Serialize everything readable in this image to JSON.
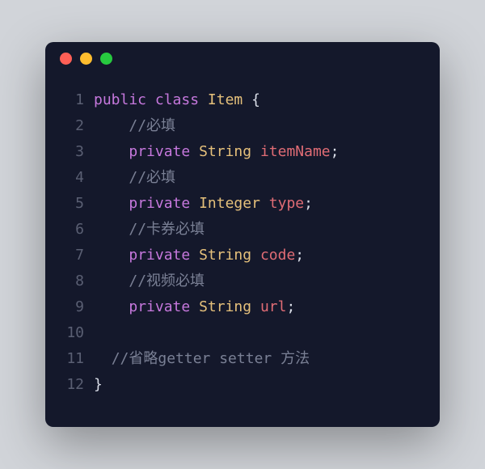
{
  "code": {
    "lines": [
      {
        "n": "1",
        "tokens": [
          {
            "c": "kw",
            "t": "public"
          },
          {
            "c": "pl",
            "t": " "
          },
          {
            "c": "kw",
            "t": "class"
          },
          {
            "c": "pl",
            "t": " "
          },
          {
            "c": "cls",
            "t": "Item"
          },
          {
            "c": "pl",
            "t": " {"
          }
        ]
      },
      {
        "n": "2",
        "tokens": [
          {
            "c": "pl",
            "t": "    "
          },
          {
            "c": "cm",
            "t": "//必填"
          }
        ]
      },
      {
        "n": "3",
        "tokens": [
          {
            "c": "pl",
            "t": "    "
          },
          {
            "c": "kw",
            "t": "private"
          },
          {
            "c": "pl",
            "t": " "
          },
          {
            "c": "ty",
            "t": "String"
          },
          {
            "c": "pl",
            "t": " "
          },
          {
            "c": "id",
            "t": "itemName"
          },
          {
            "c": "pl",
            "t": ";"
          }
        ]
      },
      {
        "n": "4",
        "tokens": [
          {
            "c": "pl",
            "t": "    "
          },
          {
            "c": "cm",
            "t": "//必填"
          }
        ]
      },
      {
        "n": "5",
        "tokens": [
          {
            "c": "pl",
            "t": "    "
          },
          {
            "c": "kw",
            "t": "private"
          },
          {
            "c": "pl",
            "t": " "
          },
          {
            "c": "ty",
            "t": "Integer"
          },
          {
            "c": "pl",
            "t": " "
          },
          {
            "c": "id",
            "t": "type"
          },
          {
            "c": "pl",
            "t": ";"
          }
        ]
      },
      {
        "n": "6",
        "tokens": [
          {
            "c": "pl",
            "t": "    "
          },
          {
            "c": "cm",
            "t": "//卡券必填"
          }
        ]
      },
      {
        "n": "7",
        "tokens": [
          {
            "c": "pl",
            "t": "    "
          },
          {
            "c": "kw",
            "t": "private"
          },
          {
            "c": "pl",
            "t": " "
          },
          {
            "c": "ty",
            "t": "String"
          },
          {
            "c": "pl",
            "t": " "
          },
          {
            "c": "id",
            "t": "code"
          },
          {
            "c": "pl",
            "t": ";"
          }
        ]
      },
      {
        "n": "8",
        "tokens": [
          {
            "c": "pl",
            "t": "    "
          },
          {
            "c": "cm",
            "t": "//视频必填"
          }
        ]
      },
      {
        "n": "9",
        "tokens": [
          {
            "c": "pl",
            "t": "    "
          },
          {
            "c": "kw",
            "t": "private"
          },
          {
            "c": "pl",
            "t": " "
          },
          {
            "c": "ty",
            "t": "String"
          },
          {
            "c": "pl",
            "t": " "
          },
          {
            "c": "id",
            "t": "url"
          },
          {
            "c": "pl",
            "t": ";"
          }
        ]
      },
      {
        "n": "10",
        "tokens": []
      },
      {
        "n": "11",
        "tokens": [
          {
            "c": "pl",
            "t": "  "
          },
          {
            "c": "cm",
            "t": "//省略getter setter 方法"
          }
        ]
      },
      {
        "n": "12",
        "tokens": [
          {
            "c": "pl",
            "t": "}"
          }
        ]
      }
    ]
  }
}
